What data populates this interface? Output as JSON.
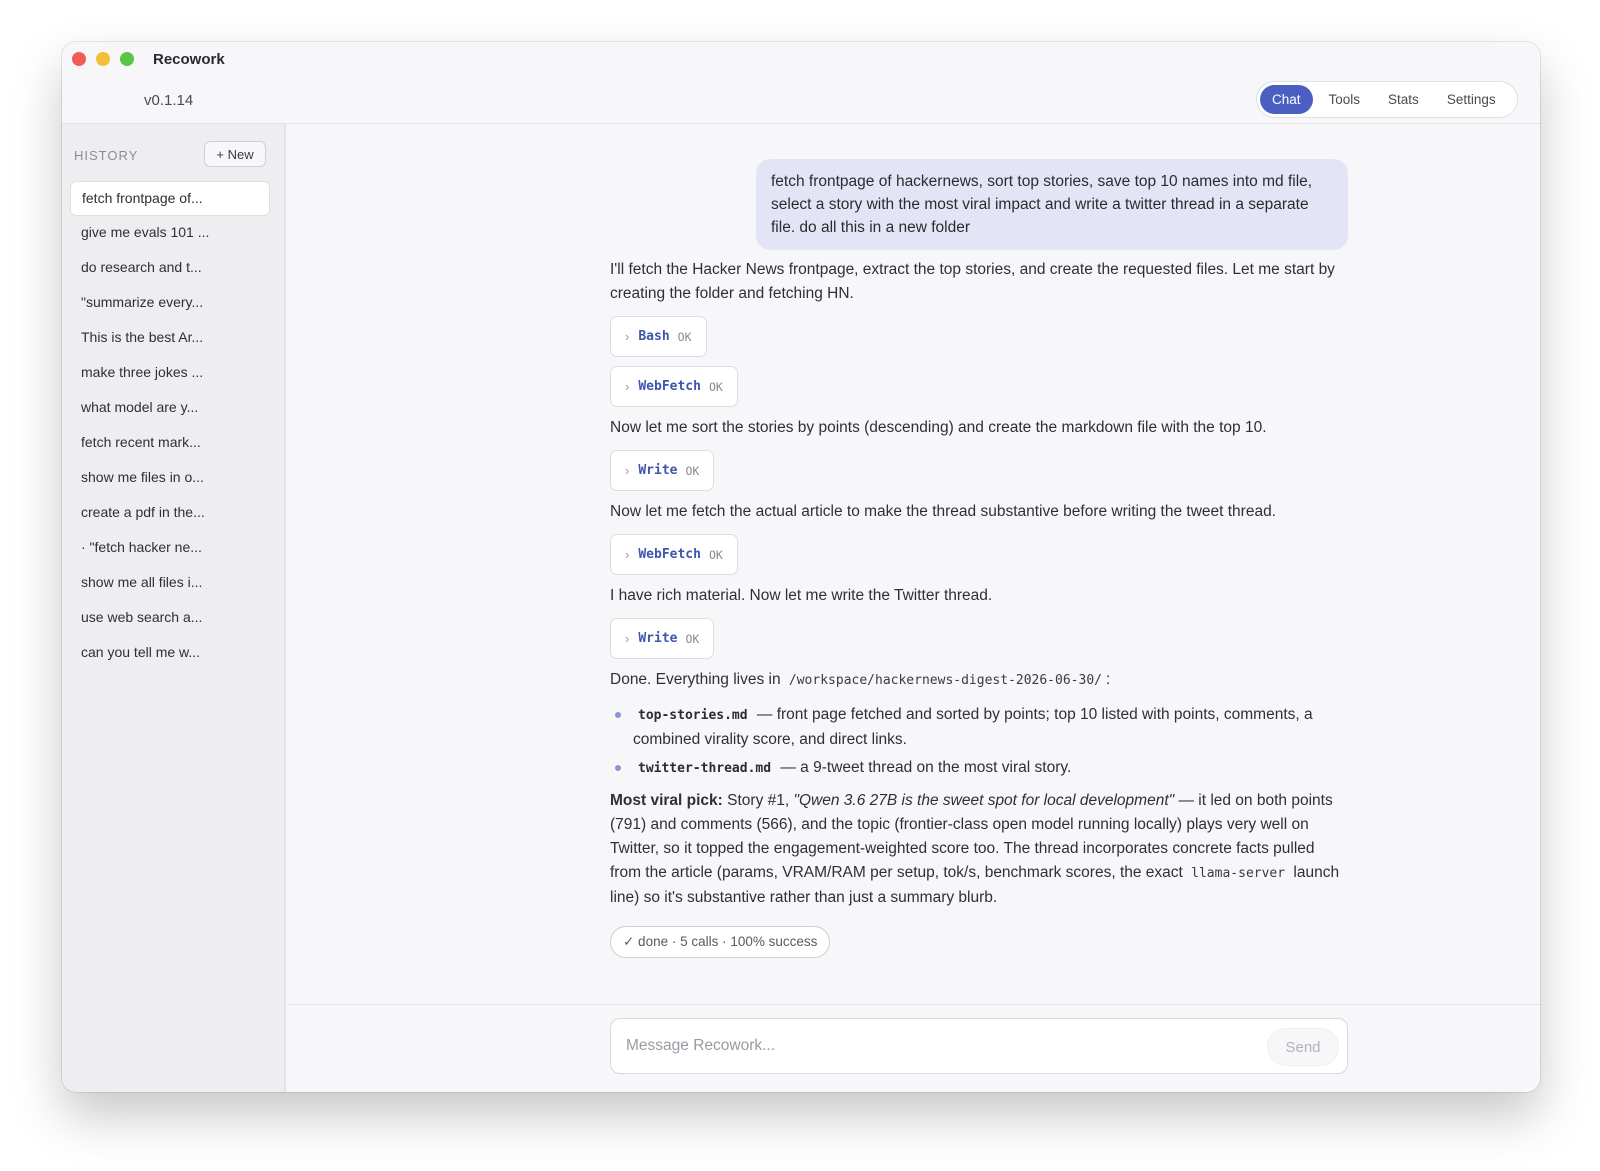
{
  "window": {
    "app_name": "Recowork",
    "version": "v0.1.14"
  },
  "nav": {
    "tabs": [
      "Chat",
      "Tools",
      "Stats",
      "Settings"
    ],
    "active": "Chat"
  },
  "sidebar": {
    "heading": "HISTORY",
    "new_button": "+ New",
    "items": [
      "fetch frontpage of...",
      "give me evals 101 ...",
      "do research and t...",
      "\"summarize every...",
      "This is the best Ar...",
      "make three jokes ...",
      "what model are y...",
      "fetch recent mark...",
      "show me files in o...",
      "create a pdf in the...",
      "· \"fetch hacker ne...",
      "show me all files i...",
      "use web search a...",
      "can you tell me w..."
    ]
  },
  "chat": {
    "user_message": "fetch frontpage of hackernews, sort top stories, save top 10 names into md file, select a story with the most viral impact and write a twitter thread in a separate file. do all this in a new folder",
    "assistant": {
      "intro": "I'll fetch the Hacker News frontpage, extract the top stories, and create the requested files. Let me start by creating the folder and fetching HN.",
      "tool_status": "OK",
      "tools": {
        "bash": "Bash",
        "webfetch1": "WebFetch",
        "write1": "Write",
        "webfetch2": "WebFetch",
        "write2": "Write"
      },
      "step2": "Now let me sort the stories by points (descending) and create the markdown file with the top 10.",
      "step3": "Now let me fetch the actual article to make the thread substantive before writing the tweet thread.",
      "step4": "I have rich material. Now let me write the Twitter thread.",
      "done_prefix": "Done. Everything lives in",
      "done_path": "/workspace/hackernews-digest-2026-06-30/",
      "done_suffix": ":",
      "bullet1_file": "top-stories.md",
      "bullet1_text": "— front page fetched and sorted by points; top 10 listed with points, comments, a combined virality score, and direct links.",
      "bullet2_file": "twitter-thread.md",
      "bullet2_text": "— a 9-tweet thread on the most viral story.",
      "pick_label": "Most viral pick:",
      "pick_story": "Story #1,",
      "pick_title": "\"Qwen 3.6 27B is the sweet spot for local development\"",
      "pick_body": "— it led on both points (791) and comments (566), and the topic (frontier-class open model running locally) plays very well on Twitter, so it topped the engagement-weighted score too. The thread incorporates concrete facts pulled from the article (params, VRAM/RAM per setup, tok/s, benchmark scores, the exact",
      "pick_code": "llama-server",
      "pick_end": "launch line) so it's substantive rather than just a summary blurb.",
      "summary": "✓ done · 5 calls · 100% success"
    }
  },
  "composer": {
    "placeholder": "Message Recowork...",
    "send_label": "Send"
  },
  "colors": {
    "accent": "#4a5fc1",
    "user_bubble": "#e3e5f6",
    "tool_name": "#3e56ad"
  }
}
